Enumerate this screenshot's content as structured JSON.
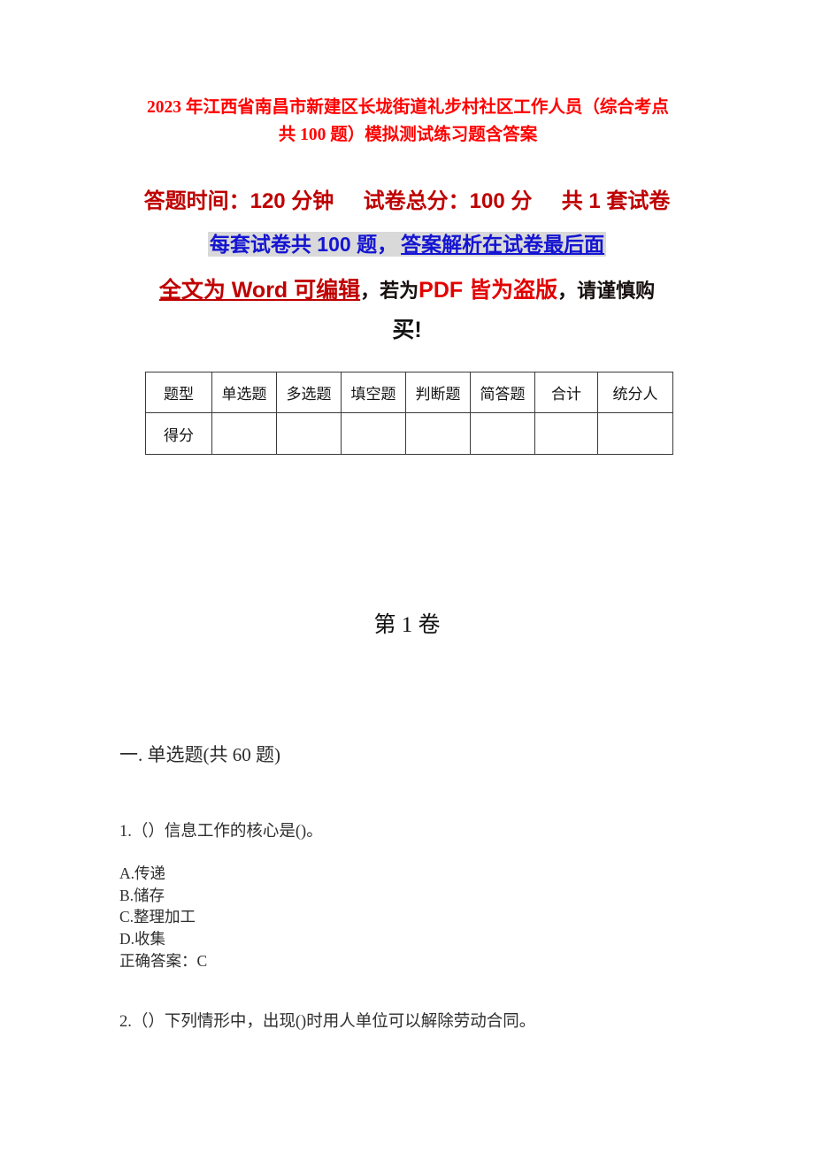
{
  "document": {
    "title": "2023 年江西省南昌市新建区长垅街道礼步村社区工作人员（综合考点共 100 题）模拟测试练习题含答案",
    "info_lines": {
      "exam_time_label": "答题时间：120 分钟",
      "total_score_label": "试卷总分：100 分",
      "set_count_label": "共 1 套试卷",
      "per_set_prefix": "每套试卷共 100 题，",
      "per_set_underlined": "答案解析在试卷最后面",
      "word_editable": "全文为 Word 可编辑",
      "if_pdf_prefix": "，若为",
      "pdf_pirated": "PDF 皆为盗版",
      "caution_suffix": "，请谨慎购",
      "caution_tail": "买!"
    },
    "volume_title": "第 1 卷",
    "section_heading": "一. 单选题(共 60 题)"
  },
  "score_table": {
    "headers": [
      "题型",
      "单选题",
      "多选题",
      "填空题",
      "判断题",
      "简答题",
      "合计",
      "统分人"
    ],
    "rows": [
      {
        "label": "得分",
        "values": [
          "",
          "",
          "",
          "",
          "",
          "",
          ""
        ]
      }
    ]
  },
  "questions": [
    {
      "stem": "1.（）信息工作的核心是()。",
      "options": [
        "A.传递",
        "B.储存",
        "C.整理加工",
        "D.收集"
      ],
      "answer": "正确答案：C"
    },
    {
      "stem": "2.（）下列情形中，出现()时用人单位可以解除劳动合同。",
      "options": [],
      "answer": ""
    }
  ],
  "colors": {
    "title_red": "#FF0000",
    "info_dark_red": "#BE0000",
    "highlight_blue": "#1414D2",
    "highlight_bg": "#D9D9D9",
    "word_red": "#C00000",
    "pdf_red": "#E30000",
    "body_text": "#2e2e2e",
    "table_border": "#3a3a3a",
    "page_bg": "#ffffff"
  }
}
